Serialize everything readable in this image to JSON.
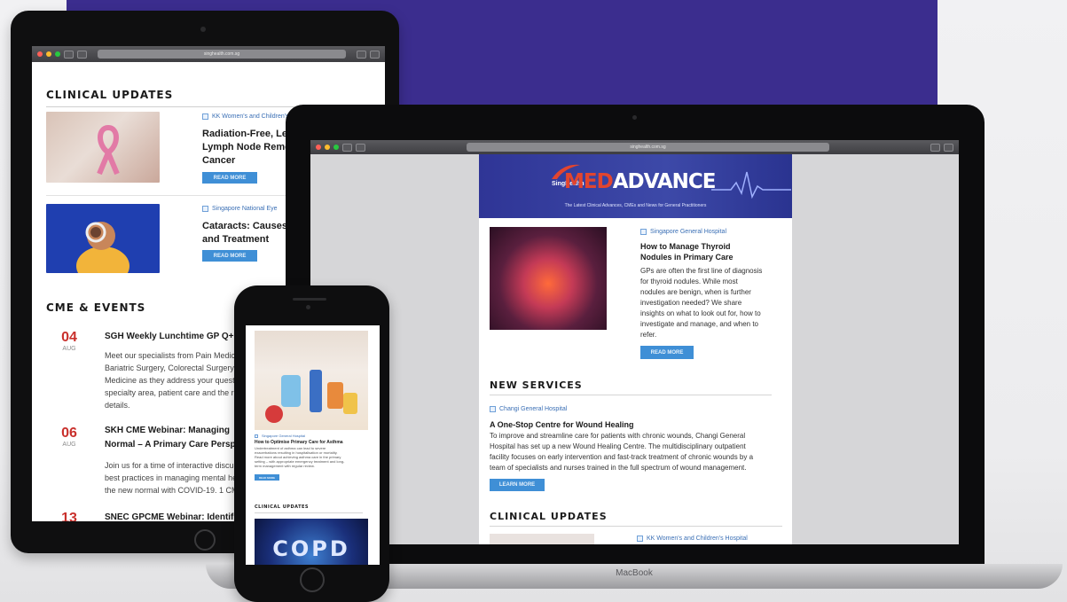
{
  "tablet": {
    "url": "singhealth.com.sg",
    "clinical_heading": "CLINICAL UPDATES",
    "articles": [
      {
        "source": "KK Women's and Children's Hospital",
        "title_lines": [
          "Radiation-Free, Lea",
          "Lymph Node Remo",
          "Cancer"
        ],
        "button": "READ MORE"
      },
      {
        "source": "Singapore National Eye",
        "title_lines": [
          "Cataracts: Causes,",
          "and Treatment"
        ],
        "button": "READ MORE"
      }
    ],
    "cme_heading": "CME & EVENTS",
    "events": [
      {
        "day": "04",
        "month": "AUG",
        "title": "SGH Weekly Lunchtime GP Q+",
        "desc": [
          "Meet our specialists from Pain Medic",
          "Bariatric Surgery, Colorectal Surgery",
          "Medicine as they address your quest",
          "specialty area, patient care and the r",
          "details."
        ]
      },
      {
        "day": "06",
        "month": "AUG",
        "title": "SKH CME Webinar: Managing",
        "title2": "Normal – A Primary Care Persp",
        "desc": [
          "Join us for a time of interactive discu",
          "best practices in managing mental he",
          "the new normal with COVID-19. 1 CM"
        ]
      },
      {
        "day": "13",
        "title": "SNEC GPCME Webinar: Identif"
      }
    ]
  },
  "laptop": {
    "url": "singhealth.com.sg",
    "brand_prefix": "SingHealth",
    "brand_med": "MED",
    "brand_advance": "ADVANCE",
    "tagline": "The Latest Clinical Advances, CMEs and News for General Practitioners",
    "feature": {
      "source": "Singapore General Hospital",
      "title_lines": [
        "How to Manage Thyroid",
        "Nodules in Primary Care"
      ],
      "desc_lines": [
        "GPs are often the first line of diagnosis",
        "for thyroid nodules. While most",
        "nodules are benign, when is further",
        "investigation needed? We share",
        "insights on what to look out for, how to",
        "investigate and manage, and when to",
        "refer."
      ],
      "button": "READ MORE"
    },
    "new_services_heading": "NEW SERVICES",
    "service": {
      "source": "Changi General Hospital",
      "title": "A One-Stop Centre for Wound Healing",
      "desc_lines": [
        "To improve and streamline care for patients with chronic wounds, Changi General",
        "Hospital has set up a new Wound Healing Centre. The multidisciplinary outpatient",
        "facility focuses on early intervention and fast-track treatment of chronic wounds by a",
        "team of specialists and nurses trained in the full spectrum of wound management."
      ],
      "button": "LEARN MORE"
    },
    "clinical_heading": "CLINICAL UPDATES",
    "clinical_source": "KK Women's and Children's Hospital",
    "base_label": "MacBook"
  },
  "phone": {
    "source": "Singapore General Hospital",
    "title": "How to Optimise Primary Care for Asthma",
    "desc_lines": [
      "Undertreatment of asthma can lead to severe",
      "exacerbations resulting in hospitalisation or mortality.",
      "Read more about achieving asthma care in the primary",
      "setting – with appropriate emergency treatment and long-",
      "term management with regular review."
    ],
    "button": "READ MORE",
    "clinical_heading": "CLINICAL UPDATES",
    "copd": "COPD"
  },
  "colors": {
    "panel": "#3b2d8e",
    "accent_blue": "#3f8fd6",
    "event_red": "#c9302c",
    "header_blue": "#2f3596"
  }
}
